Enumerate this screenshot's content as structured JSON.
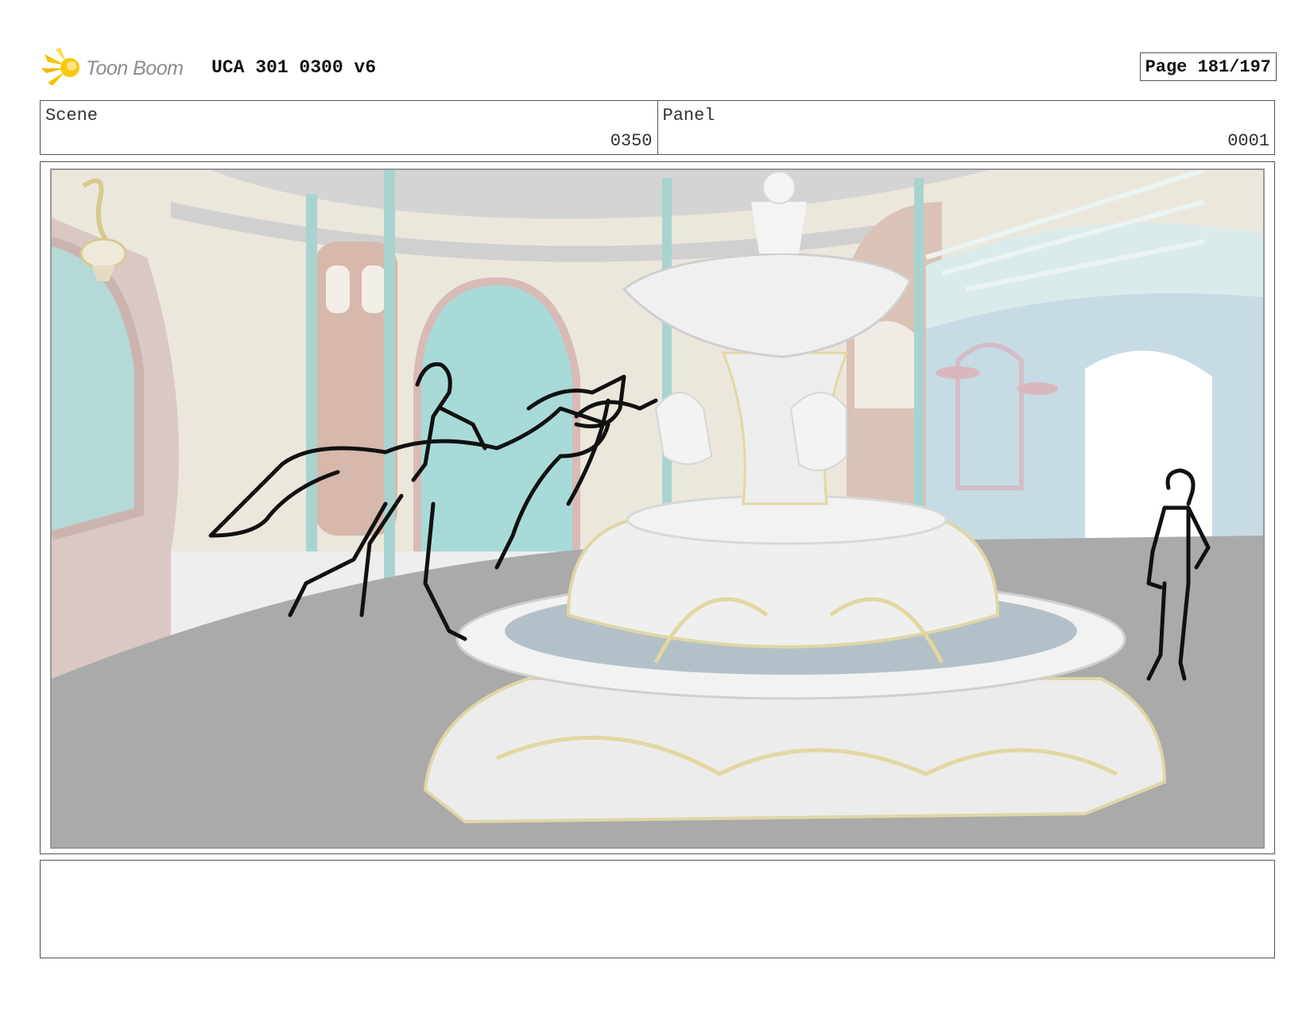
{
  "header": {
    "logo_text": "Toon Boom",
    "title": "UCA 301 0300 v6",
    "page": "Page 181/197"
  },
  "info": {
    "scene_label": "Scene",
    "scene_value": "0350",
    "panel_label": "Panel",
    "panel_value": "0001"
  },
  "colors": {
    "accent": "#f5c400",
    "floor": "#aaaaaa",
    "wall": "#ece7dc",
    "teal": "#a8d4d0",
    "pink_wall": "#d8c1bc",
    "fountain": "#ebebeb",
    "gold_trim": "#e2d7a2"
  },
  "notes": {
    "text": ""
  }
}
